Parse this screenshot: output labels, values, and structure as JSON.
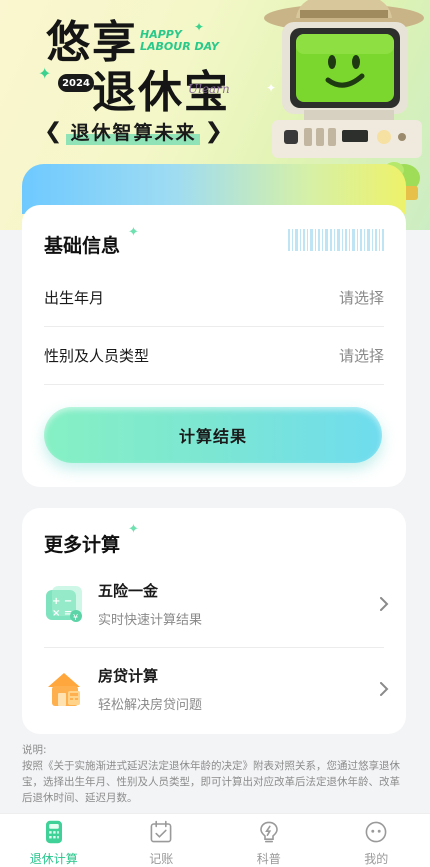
{
  "hero": {
    "title_line1": "悠享",
    "title_line2": "退休宝",
    "happy_line1": "HAPPY",
    "happy_line2": "LABOUR DAY",
    "year_badge": "2024",
    "script_text": "Ulearn",
    "slogan": "退休智算未来",
    "slogan_left": "❮",
    "slogan_right": "❯"
  },
  "basic": {
    "title": "基础信息",
    "rows": [
      {
        "label": "出生年月",
        "value": "请选择"
      },
      {
        "label": "性别及人员类型",
        "value": "请选择"
      }
    ],
    "button_label": "计算结果"
  },
  "more": {
    "title": "更多计算",
    "items": [
      {
        "name": "五险一金",
        "desc": "实时快速计算结果",
        "icon": "calculator-icon"
      },
      {
        "name": "房贷计算",
        "desc": "轻松解决房贷问题",
        "icon": "house-icon"
      }
    ]
  },
  "note": {
    "heading": "说明:",
    "body": "按照《关于实施渐进式延迟法定退休年龄的决定》附表对照关系，您通过悠享退休宝，选择出生年月、性别及人员类型，即可计算出对应改革后法定退休年龄、改革后退休时间、延迟月数。"
  },
  "tabbar": {
    "tabs": [
      {
        "label": "退休计算",
        "icon": "calculator-tab-icon",
        "active": true
      },
      {
        "label": "记账",
        "icon": "ledger-check-icon",
        "active": false
      },
      {
        "label": "科普",
        "icon": "lightbulb-icon",
        "active": false
      },
      {
        "label": "我的",
        "icon": "profile-face-icon",
        "active": false
      }
    ]
  },
  "colors": {
    "accent": "#27c58c",
    "button_gradient_start": "#86f0c4",
    "button_gradient_end": "#6fdcef",
    "page_bg": "#f3f4f6"
  }
}
